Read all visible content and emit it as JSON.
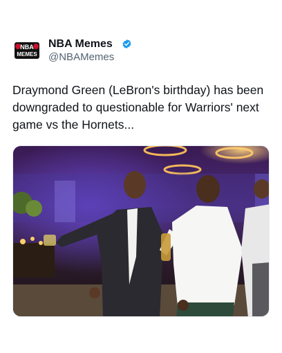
{
  "tweet": {
    "author": {
      "display_name": "NBA Memes",
      "handle": "@NBAMemes",
      "verified": true,
      "verified_icon": "verified-badge-icon",
      "avatar_text_top": "NBA",
      "avatar_text_bottom": "MEMES"
    },
    "text": "Draymond Green (LeBron's birthday) has been downgraded to questionable for Warriors' next game vs the Hornets...",
    "media": {
      "kind": "photo"
    }
  },
  "colors": {
    "text": "#0f1419",
    "secondary_text": "#536471",
    "verified": "#1d9bf0",
    "avatar_bg": "#111111",
    "avatar_accent": "#c8102e"
  }
}
